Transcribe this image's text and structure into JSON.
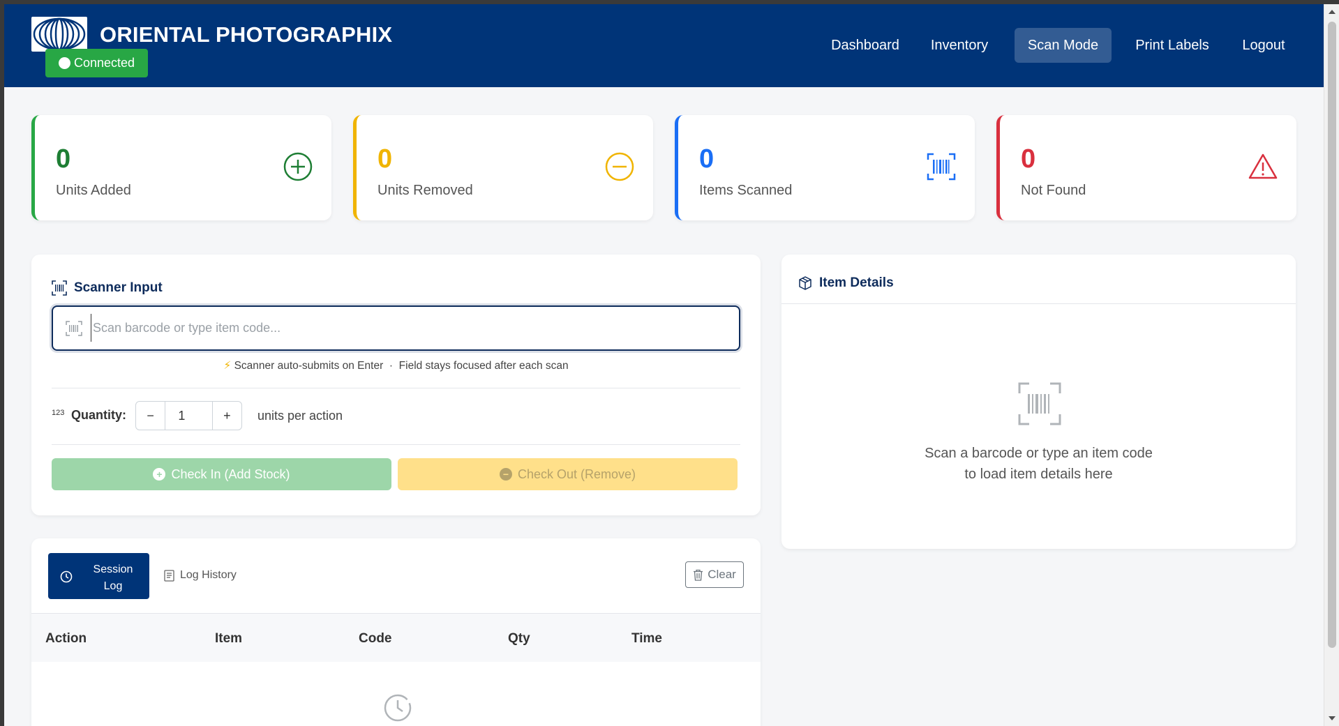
{
  "header": {
    "brand": "ORIENTAL PHOTOGRAPHIX",
    "status": "Connected",
    "nav": [
      {
        "label": "Dashboard",
        "active": false
      },
      {
        "label": "Inventory",
        "active": false
      },
      {
        "label": "Scan Mode",
        "active": true
      },
      {
        "label": "Print Labels",
        "active": false
      },
      {
        "label": "Logout",
        "active": false
      }
    ]
  },
  "stats": [
    {
      "value": "0",
      "label": "Units Added",
      "color": "#1e7e34",
      "icon": "plus-circle-icon"
    },
    {
      "value": "0",
      "label": "Units Removed",
      "color": "#f0b400",
      "icon": "minus-circle-icon"
    },
    {
      "value": "0",
      "label": "Items Scanned",
      "color": "#1a6ef5",
      "icon": "barcode-scan-icon"
    },
    {
      "value": "0",
      "label": "Not Found",
      "color": "#d9303e",
      "icon": "warning-triangle-icon"
    }
  ],
  "scanner": {
    "title": "Scanner Input",
    "placeholder": "Scan barcode or type item code...",
    "hint_a": "Scanner auto-submits on Enter",
    "hint_sep": "·",
    "hint_b": "Field stays focused after each scan",
    "qty_badge": "123",
    "qty_label": "Quantity:",
    "qty_minus": "−",
    "qty_value": "1",
    "qty_plus": "+",
    "qty_units": "units per action",
    "check_in": "Check In (Add Stock)",
    "check_out": "Check Out (Remove)"
  },
  "details": {
    "title": "Item Details",
    "empty_line1": "Scan a barcode or type an item code",
    "empty_line2": "to load item details here"
  },
  "log": {
    "tab_session": "Session Log",
    "tab_history": "Log History",
    "clear": "Clear",
    "columns": [
      "Action",
      "Item",
      "Code",
      "Qty",
      "Time"
    ]
  }
}
